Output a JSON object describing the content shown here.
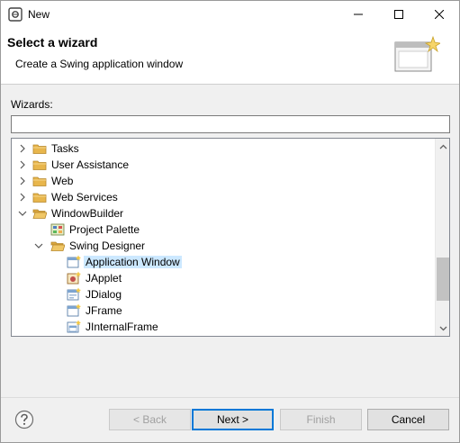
{
  "window": {
    "title": "New",
    "minimize_icon": "minimize-icon",
    "maximize_icon": "maximize-icon",
    "close_icon": "close-icon"
  },
  "banner": {
    "title": "Select a wizard",
    "description": "Create a Swing application window",
    "graphic_icon": "wizard-window-graphic-icon"
  },
  "wizards": {
    "label": "Wizards:",
    "filter_value": "",
    "filter_placeholder": ""
  },
  "tree": {
    "items": [
      {
        "label": "Tasks",
        "level": 0,
        "expanded": false,
        "icon": "folder-icon",
        "selected": false
      },
      {
        "label": "User Assistance",
        "level": 0,
        "expanded": false,
        "icon": "folder-icon",
        "selected": false
      },
      {
        "label": "Web",
        "level": 0,
        "expanded": false,
        "icon": "folder-icon",
        "selected": false
      },
      {
        "label": "Web Services",
        "level": 0,
        "expanded": false,
        "icon": "folder-icon",
        "selected": false
      },
      {
        "label": "WindowBuilder",
        "level": 0,
        "expanded": true,
        "icon": "folder-icon",
        "selected": false
      },
      {
        "label": "Project Palette",
        "level": 1,
        "expanded": null,
        "icon": "palette-icon",
        "selected": false
      },
      {
        "label": "Swing Designer",
        "level": 1,
        "expanded": true,
        "icon": "folder-icon",
        "selected": false
      },
      {
        "label": "Application Window",
        "level": 2,
        "expanded": null,
        "icon": "application-window-icon",
        "selected": true
      },
      {
        "label": "JApplet",
        "level": 2,
        "expanded": null,
        "icon": "japplet-icon",
        "selected": false
      },
      {
        "label": "JDialog",
        "level": 2,
        "expanded": null,
        "icon": "jdialog-icon",
        "selected": false
      },
      {
        "label": "JFrame",
        "level": 2,
        "expanded": null,
        "icon": "jframe-icon",
        "selected": false
      },
      {
        "label": "JInternalFrame",
        "level": 2,
        "expanded": null,
        "icon": "jinternalframe-icon",
        "selected": false
      }
    ],
    "selection_color": "#cce8ff",
    "folder_color": "#e8b64c"
  },
  "buttons": {
    "help_icon": "help-icon",
    "back": "< Back",
    "next": "Next >",
    "finish": "Finish",
    "cancel": "Cancel"
  }
}
